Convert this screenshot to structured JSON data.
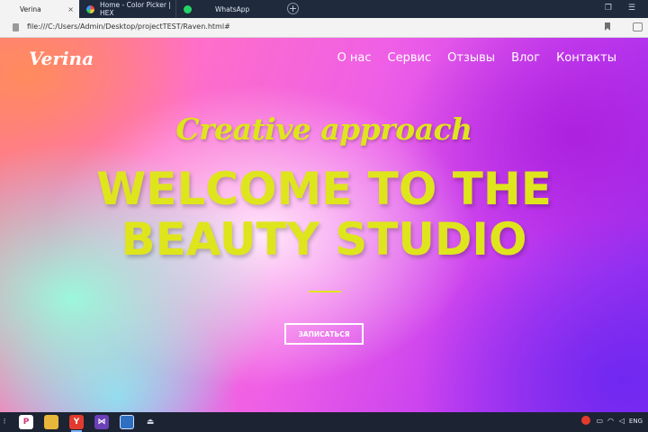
{
  "browser": {
    "tabs": [
      {
        "title": "Verina",
        "active": true,
        "close": "×"
      },
      {
        "title": "Home - Color Picker | HEX",
        "active": false
      },
      {
        "title": "WhatsApp",
        "active": false
      }
    ],
    "new_tab": "+",
    "address": "file:///C:/Users/Admin/Desktop/projectTEST/Raven.html#"
  },
  "site": {
    "logo": "Verina",
    "nav": [
      "О нас",
      "Сервис",
      "Отзывы",
      "Влог",
      "Контакты"
    ],
    "tagline": "Creative approach",
    "headline_line1": "WELCOME TO THE",
    "headline_line2": "BEAUTY STUDIO",
    "cta": "ЗАПИСАТЬСЯ"
  },
  "taskbar": {
    "language": "ENG"
  },
  "colors": {
    "accent_yellow": "#dfe51c",
    "tabstrip": "#1f2a3c",
    "taskbar": "#1c2333"
  }
}
